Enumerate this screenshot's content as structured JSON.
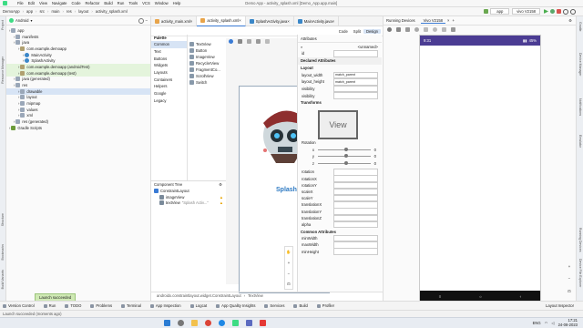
{
  "menubar": {
    "items": [
      "File",
      "Edit",
      "View",
      "Navigate",
      "Code",
      "Refactor",
      "Build",
      "Run",
      "Tools",
      "VCS",
      "Window",
      "Help"
    ],
    "window_title": "Demo App - activity_splash.xml [Demo_App.app.main]"
  },
  "navbar": {
    "crumbs": [
      "DemoApp",
      "app",
      "src",
      "main",
      "res",
      "layout",
      "activity_splash.xml"
    ],
    "device": "app",
    "vivo": "vivo V2158",
    "search_icon": "search-icon"
  },
  "left_strip": [
    "Project",
    "Resource Manager",
    "Structure",
    "Bookmarks",
    "Build Variants"
  ],
  "right_strip": [
    "Gradle",
    "Device Manager",
    "Notifications",
    "Emulator",
    "Running Devices",
    "Device File Explorer"
  ],
  "project": {
    "view": "Android",
    "items": [
      {
        "label": "app",
        "depth": 0,
        "icon": "folder-icon"
      },
      {
        "label": "manifests",
        "depth": 1,
        "icon": "folder-icon"
      },
      {
        "label": "java",
        "depth": 1,
        "icon": "folder-icon"
      },
      {
        "label": "com.example.demoapp",
        "depth": 2,
        "icon": "package-icon"
      },
      {
        "label": "MainActivity",
        "depth": 3,
        "icon": "class-icon"
      },
      {
        "label": "SplashActivity",
        "depth": 3,
        "icon": "class-icon"
      },
      {
        "label": "com.example.demoapp (androidTest)",
        "depth": 2,
        "icon": "package-icon",
        "hl": true
      },
      {
        "label": "com.example.demoapp (test)",
        "depth": 2,
        "icon": "package-icon",
        "hl": true
      },
      {
        "label": "java (generated)",
        "depth": 1,
        "icon": "folder-icon"
      },
      {
        "label": "res",
        "depth": 1,
        "icon": "folder-icon"
      },
      {
        "label": "drawable",
        "depth": 2,
        "icon": "folder-icon",
        "sel": true
      },
      {
        "label": "layout",
        "depth": 2,
        "icon": "folder-icon"
      },
      {
        "label": "mipmap",
        "depth": 2,
        "icon": "folder-icon"
      },
      {
        "label": "values",
        "depth": 2,
        "icon": "folder-icon"
      },
      {
        "label": "xml",
        "depth": 2,
        "icon": "folder-icon"
      },
      {
        "label": "res (generated)",
        "depth": 1,
        "icon": "folder-icon"
      },
      {
        "label": "Gradle Scripts",
        "depth": 0,
        "icon": "gradle-icon"
      }
    ]
  },
  "editor": {
    "tabs": [
      "activity_main.xml",
      "activity_splash.xml",
      "SplashActivity.java",
      "MainActivity.java"
    ],
    "active_tab": 1,
    "modes": [
      "Code",
      "Split",
      "Design"
    ],
    "palette_title": "Palette",
    "palette_categories": [
      "Common",
      "Text",
      "Buttons",
      "Widgets",
      "Layouts",
      "Containers",
      "Helpers",
      "Google",
      "Legacy"
    ],
    "palette_items": [
      "TextView",
      "Button",
      "ImageView",
      "RecyclerView",
      "FragmentCo...",
      "ScrollView",
      "Switch"
    ],
    "splash_text": "Splash Ac",
    "component_tree_title": "Component Tree",
    "component_tree": [
      {
        "label": "ConstraintLayout",
        "depth": 0
      },
      {
        "label": "imageView",
        "depth": 1,
        "warn": true
      },
      {
        "label": "textView",
        "depth": 1,
        "extra": "\"Splash Activ...\"",
        "warn": true
      }
    ],
    "breadcrumb": "androidx.constraintlayout.widget.ConstraintLayout",
    "breadcrumb2": "TextView"
  },
  "attributes": {
    "title": "Attributes",
    "unnamed": "<unnamed>",
    "id": "id",
    "declared": "Declared Attributes",
    "layout_title": "Layout",
    "layout_rows": [
      {
        "name": "layout_width",
        "value": "match_parent"
      },
      {
        "name": "layout_height",
        "value": "match_parent"
      },
      {
        "name": "visibility",
        "value": ""
      },
      {
        "name": "visibility",
        "value": ""
      }
    ],
    "transforms": "Transforms",
    "view_label": "View",
    "rotation": "Rotation",
    "rot_axes": [
      {
        "axis": "x",
        "val": "0"
      },
      {
        "axis": "y",
        "val": "0"
      },
      {
        "axis": "z",
        "val": "0"
      }
    ],
    "fields": [
      "rotation",
      "rotationX",
      "rotationY",
      "scaleX",
      "scaleY",
      "translationX",
      "translationY",
      "translationZ",
      "alpha"
    ],
    "common": "Common Attributes",
    "common_fields": [
      "minWidth",
      "maxWidth",
      "minHeight"
    ]
  },
  "running": {
    "title": "Running Devices",
    "device_tab": "Vivo V2158",
    "phone_time": "9:31",
    "battery": "45%"
  },
  "status": {
    "toast": "Launch succeeded",
    "message": "Launch succeeded (moments ago)",
    "layout_inspector": "Layout Inspector",
    "bottom_tools": [
      "Version Control",
      "Run",
      "TODO",
      "Problems",
      "Terminal",
      "App Inspection",
      "Logcat",
      "App Quality Insights",
      "Services",
      "Build",
      "Profiler"
    ]
  },
  "taskbar": {
    "lang": "ENG",
    "time": "17:21",
    "date": "24-08-2023"
  },
  "colors": {
    "accent": "#3a7bd5",
    "phone_bar": "#4b3c93",
    "splash_text": "#2b78c2",
    "warn": "#e8a400",
    "toast": "#cfe9b4"
  }
}
